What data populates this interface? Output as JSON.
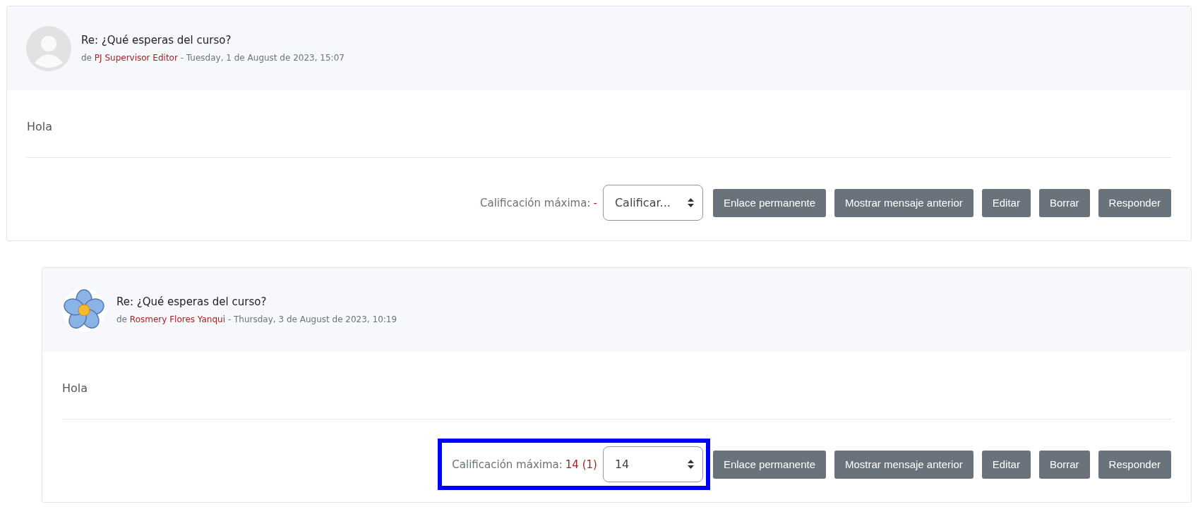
{
  "posts": [
    {
      "avatar": {
        "kind": "person"
      },
      "title": "Re: ¿Qué esperas del curso?",
      "byline_prefix": "de",
      "author": "PJ Supervisor Editor",
      "date": "- Tuesday, 1 de August de 2023, 15:07",
      "body": "Hola",
      "rating_label": "Calificación máxima:",
      "rating_value": "-",
      "select_value": "Calificar...",
      "highlighted": false,
      "buttons": [
        "Enlace permanente",
        "Mostrar mensaje anterior",
        "Editar",
        "Borrar",
        "Responder"
      ],
      "children": [
        {
          "avatar": {
            "kind": "flower"
          },
          "title": "Re: ¿Qué esperas del curso?",
          "byline_prefix": "de",
          "author": "Rosmery Flores Yanqui",
          "date": "- Thursday, 3 de August de 2023, 10:19",
          "body": "Hola",
          "rating_label": "Calificación máxima:",
          "rating_value": "14 (1)",
          "select_value": "14",
          "highlighted": true,
          "buttons": [
            "Enlace permanente",
            "Mostrar mensaje anterior",
            "Editar",
            "Borrar",
            "Responder"
          ]
        }
      ]
    }
  ]
}
